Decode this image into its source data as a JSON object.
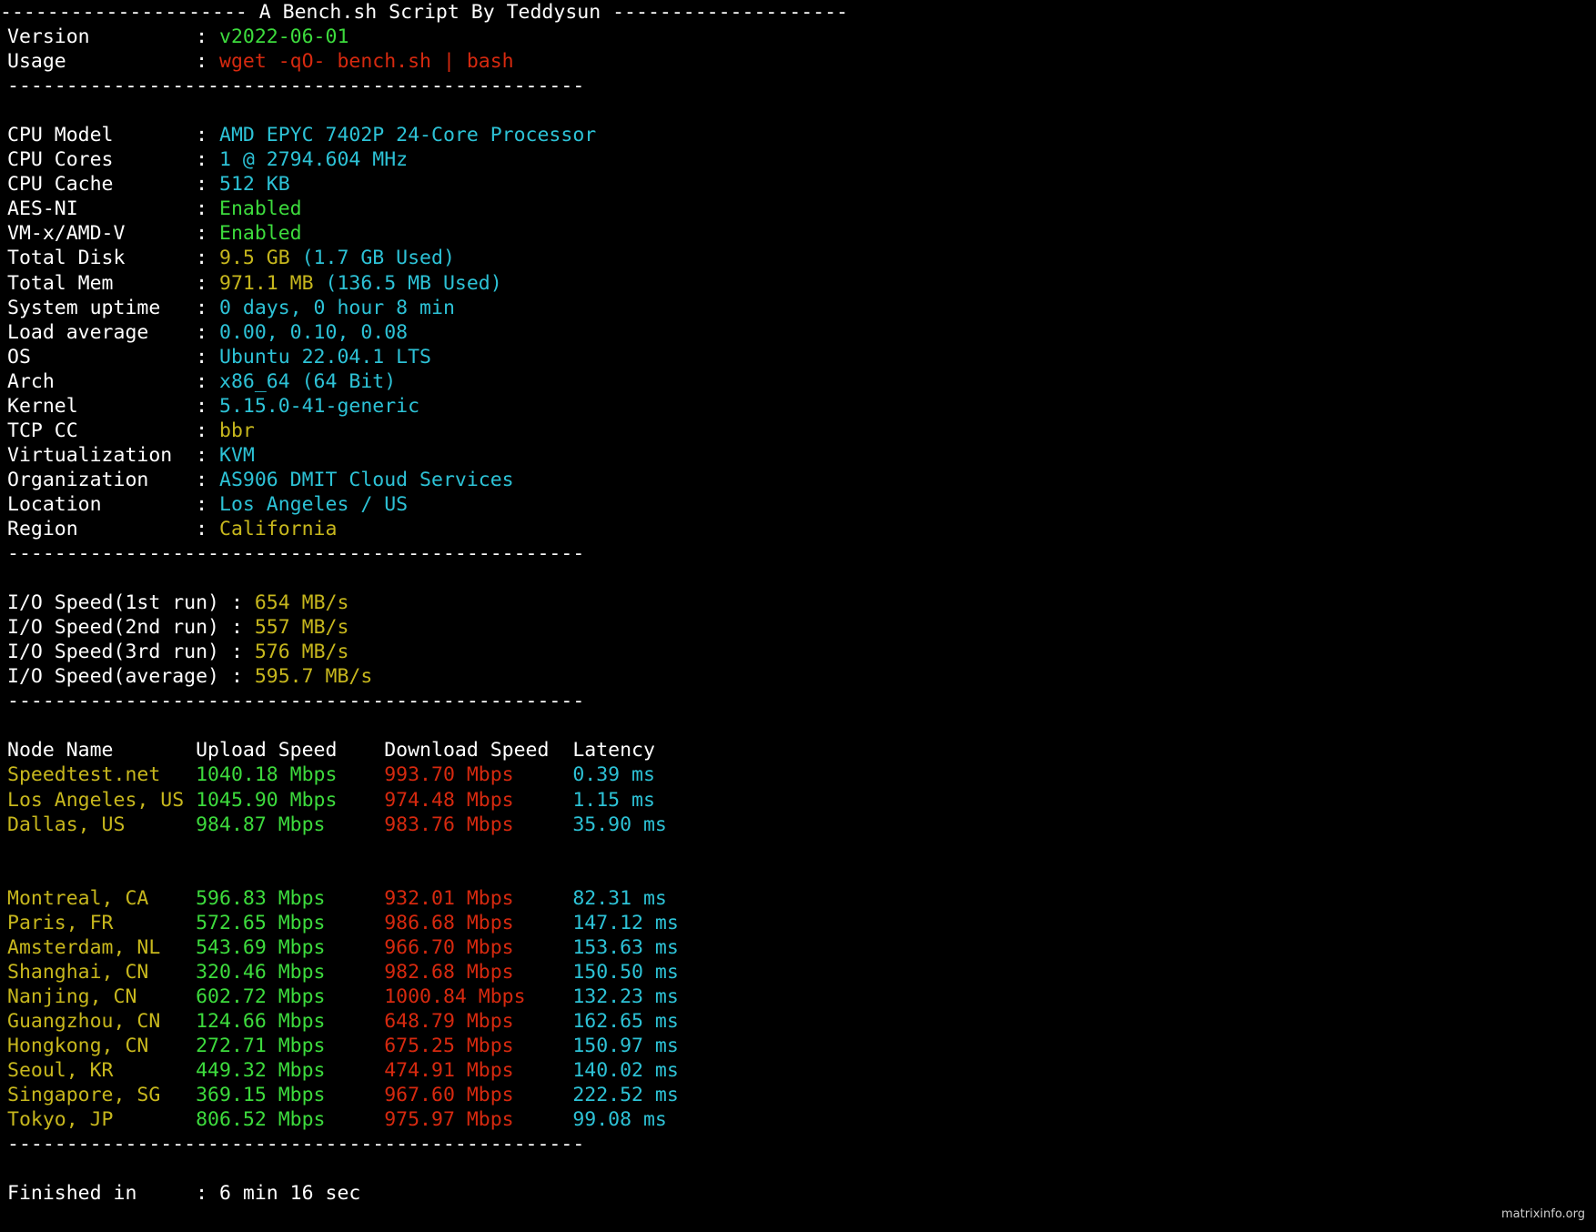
{
  "title_bar": {
    "left_rule": "---------------------",
    "text": " A Bench.sh Script By Teddysun ",
    "right_rule": "--------------------"
  },
  "divider": "-------------------------------------------------",
  "header_info": {
    "rows": [
      {
        "label": "Version",
        "sep": ":",
        "value": "v2022-06-01",
        "color": "green"
      },
      {
        "label": "Usage",
        "sep": ":",
        "value": "wget -qO- bench.sh | bash",
        "color": "red"
      }
    ]
  },
  "system_info": {
    "rows": [
      {
        "label": "CPU Model",
        "sep": ":",
        "value": "AMD EPYC 7402P 24-Core Processor",
        "color": "cyan"
      },
      {
        "label": "CPU Cores",
        "sep": ":",
        "value": "1 @ 2794.604 MHz",
        "color": "cyan"
      },
      {
        "label": "CPU Cache",
        "sep": ":",
        "value": "512 KB",
        "color": "cyan"
      },
      {
        "label": "AES-NI",
        "sep": ":",
        "value": "Enabled",
        "color": "green"
      },
      {
        "label": "VM-x/AMD-V",
        "sep": ":",
        "value": "Enabled",
        "color": "green"
      },
      {
        "label": "Total Disk",
        "sep": ":",
        "value": "9.5 GB",
        "color": "yellow",
        "value2": " (1.7 GB Used)",
        "color2": "cyan"
      },
      {
        "label": "Total Mem",
        "sep": ":",
        "value": "971.1 MB",
        "color": "yellow",
        "value2": " (136.5 MB Used)",
        "color2": "cyan"
      },
      {
        "label": "System uptime",
        "sep": ":",
        "value": "0 days, 0 hour 8 min",
        "color": "cyan"
      },
      {
        "label": "Load average",
        "sep": ":",
        "value": "0.00, 0.10, 0.08",
        "color": "cyan"
      },
      {
        "label": "OS",
        "sep": ":",
        "value": "Ubuntu 22.04.1 LTS",
        "color": "cyan"
      },
      {
        "label": "Arch",
        "sep": ":",
        "value": "x86_64 (64 Bit)",
        "color": "cyan"
      },
      {
        "label": "Kernel",
        "sep": ":",
        "value": "5.15.0-41-generic",
        "color": "cyan"
      },
      {
        "label": "TCP CC",
        "sep": ":",
        "value": "bbr",
        "color": "yellow"
      },
      {
        "label": "Virtualization",
        "sep": ":",
        "value": "KVM",
        "color": "cyan"
      },
      {
        "label": "Organization",
        "sep": ":",
        "value": "AS906 DMIT Cloud Services",
        "color": "cyan"
      },
      {
        "label": "Location",
        "sep": ":",
        "value": "Los Angeles / US",
        "color": "cyan"
      },
      {
        "label": "Region",
        "sep": ":",
        "value": "California",
        "color": "yellow"
      }
    ]
  },
  "io_speed": {
    "rows": [
      {
        "label": "I/O Speed(1st run)",
        "sep": ":",
        "value": "654 MB/s",
        "color": "yellow"
      },
      {
        "label": "I/O Speed(2nd run)",
        "sep": ":",
        "value": "557 MB/s",
        "color": "yellow"
      },
      {
        "label": "I/O Speed(3rd run)",
        "sep": ":",
        "value": "576 MB/s",
        "color": "yellow"
      },
      {
        "label": "I/O Speed(average)",
        "sep": ":",
        "value": "595.7 MB/s",
        "color": "yellow"
      }
    ]
  },
  "speedtest": {
    "columns": [
      "Node Name",
      "Upload Speed",
      "Download Speed",
      "Latency"
    ],
    "rows": [
      {
        "node": "Speedtest.net",
        "upload": "1040.18 Mbps",
        "download": "993.70 Mbps",
        "latency": "0.39 ms"
      },
      {
        "node": "Los Angeles, US",
        "upload": "1045.90 Mbps",
        "download": "974.48 Mbps",
        "latency": "1.15 ms"
      },
      {
        "node": "Dallas, US",
        "upload": "984.87 Mbps",
        "download": "983.76 Mbps",
        "latency": "35.90 ms"
      },
      {
        "node": "",
        "upload": "",
        "download": "",
        "latency": ""
      },
      {
        "node": "",
        "upload": "",
        "download": "",
        "latency": ""
      },
      {
        "node": "Montreal, CA",
        "upload": "596.83 Mbps",
        "download": "932.01 Mbps",
        "latency": "82.31 ms"
      },
      {
        "node": "Paris, FR",
        "upload": "572.65 Mbps",
        "download": "986.68 Mbps",
        "latency": "147.12 ms"
      },
      {
        "node": "Amsterdam, NL",
        "upload": "543.69 Mbps",
        "download": "966.70 Mbps",
        "latency": "153.63 ms"
      },
      {
        "node": "Shanghai, CN",
        "upload": "320.46 Mbps",
        "download": "982.68 Mbps",
        "latency": "150.50 ms"
      },
      {
        "node": "Nanjing, CN",
        "upload": "602.72 Mbps",
        "download": "1000.84 Mbps",
        "latency": "132.23 ms"
      },
      {
        "node": "Guangzhou, CN",
        "upload": "124.66 Mbps",
        "download": "648.79 Mbps",
        "latency": "162.65 ms"
      },
      {
        "node": "Hongkong, CN",
        "upload": "272.71 Mbps",
        "download": "675.25 Mbps",
        "latency": "150.97 ms"
      },
      {
        "node": "Seoul, KR",
        "upload": "449.32 Mbps",
        "download": "474.91 Mbps",
        "latency": "140.02 ms"
      },
      {
        "node": "Singapore, SG",
        "upload": "369.15 Mbps",
        "download": "967.60 Mbps",
        "latency": "222.52 ms"
      },
      {
        "node": "Tokyo, JP",
        "upload": "806.52 Mbps",
        "download": "975.97 Mbps",
        "latency": "99.08 ms"
      }
    ]
  },
  "footer": {
    "label": "Finished in",
    "sep": ":",
    "value": "6 min 16 sec",
    "watermark": "matrixinfo.org"
  },
  "colors": {
    "background": "#000000",
    "foreground": "#ffffff",
    "green": "#3ddb3d",
    "red": "#d6290f",
    "cyan": "#2dc2d6",
    "yellow": "#c7b71d"
  }
}
